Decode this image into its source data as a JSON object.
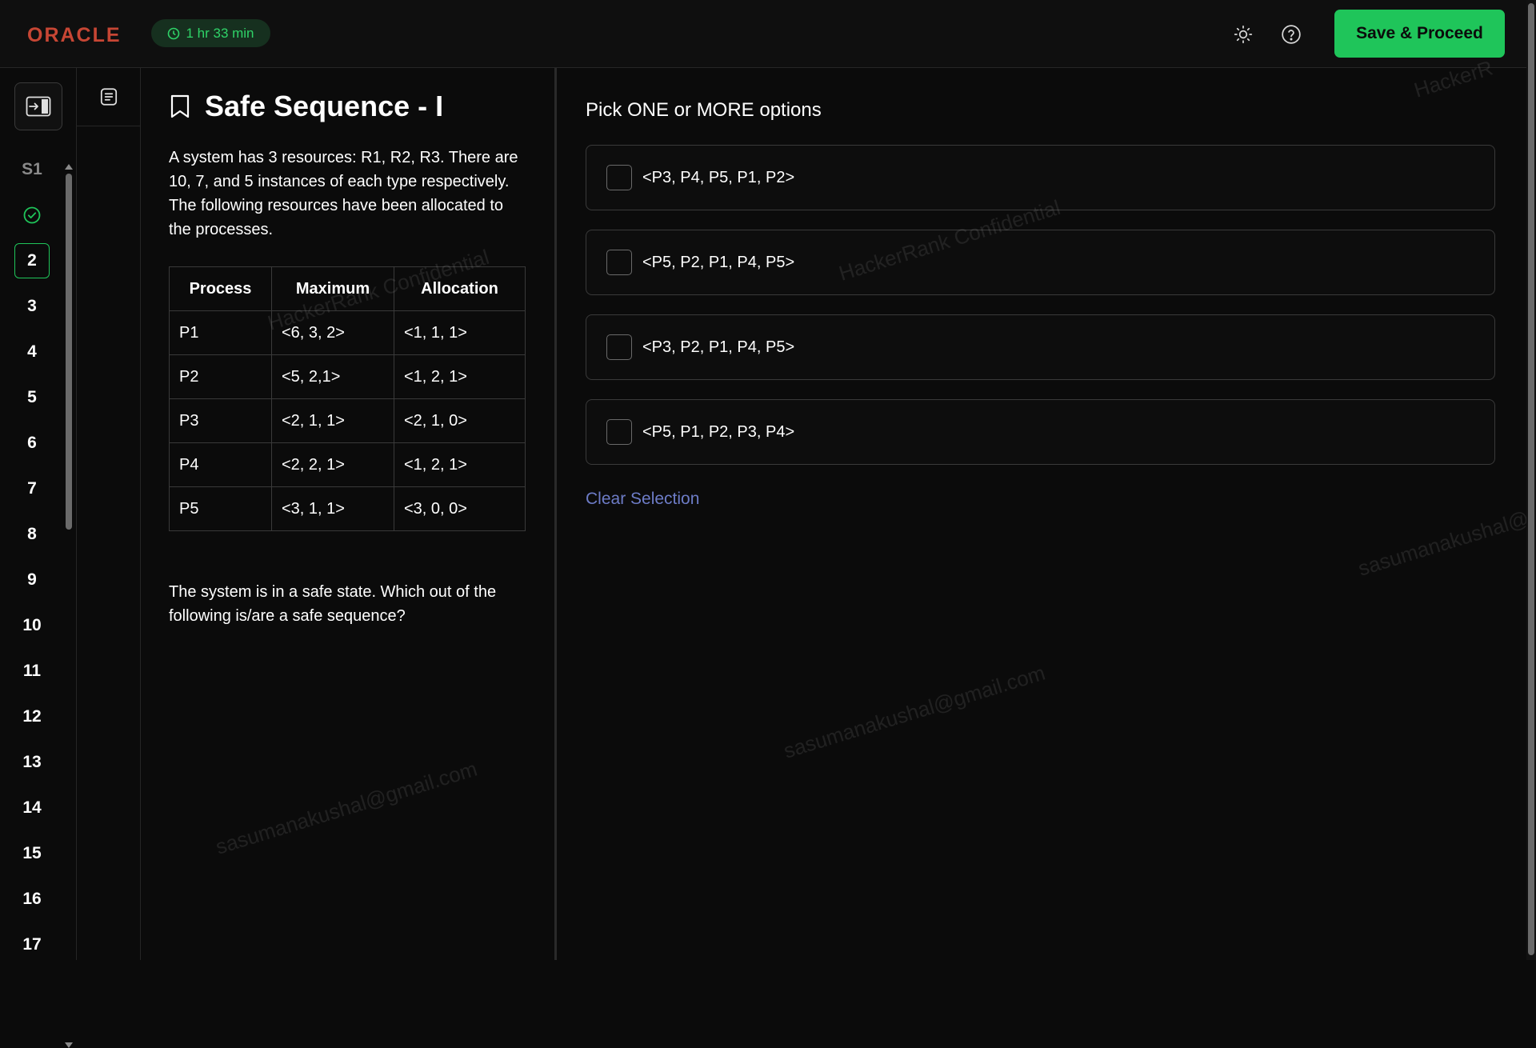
{
  "header": {
    "logo_text": "ORACLE",
    "timer": "1 hr 33 min",
    "theme_icon": "sun-icon",
    "help_icon": "help-circle-icon",
    "save_label": "Save & Proceed"
  },
  "nav": {
    "section_label": "S1",
    "questions": [
      "2",
      "3",
      "4",
      "5",
      "6",
      "7",
      "8",
      "9",
      "10",
      "11",
      "12",
      "13",
      "14",
      "15",
      "16",
      "17"
    ],
    "current": "2",
    "answered_icon": "check-circle-icon"
  },
  "question": {
    "title": "Safe Sequence - I",
    "text_1": "A system has 3 resources: R1, R2, R3. There are 10, 7, and 5 instances of each type respectively. The following resources have been allocated to the processes.",
    "table": {
      "headers": [
        "Process",
        "Maximum",
        "Allocation"
      ],
      "rows": [
        [
          "P1",
          "<6, 3, 2>",
          "<1, 1, 1>"
        ],
        [
          "P2",
          "<5, 2,1>",
          "<1, 2, 1>"
        ],
        [
          "P3",
          "<2, 1, 1>",
          "<2, 1, 0>"
        ],
        [
          "P4",
          "<2, 2, 1>",
          "<1, 2, 1>"
        ],
        [
          "P5",
          "<3, 1, 1>",
          "<3, 0, 0>"
        ]
      ]
    },
    "text_2": "The system is in a safe state. Which out of the following is/are a safe sequence?"
  },
  "answers": {
    "instruction": "Pick ONE or MORE options",
    "options": [
      "<P3, P4, P5, P1, P2>",
      "<P5, P2, P1, P4, P5>",
      "<P3, P2, P1, P4, P5>",
      "<P5, P1, P2, P3, P4>"
    ],
    "clear_label": "Clear Selection"
  },
  "watermarks": {
    "email": "sasumanakushal@gmail.com",
    "confidential": "HackerRank Confidential",
    "partial_top": "HackerR",
    "partial_right": "sasumanakushal@"
  }
}
